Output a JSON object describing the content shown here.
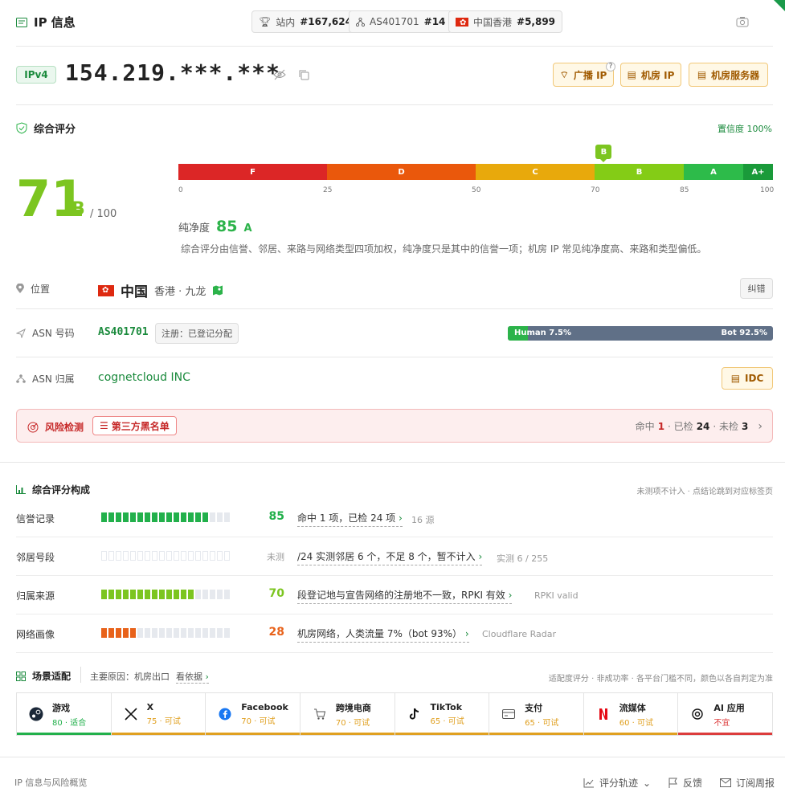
{
  "header": {
    "title": "IP 信息",
    "ranks": [
      {
        "label": "站内",
        "value": "#167,624"
      },
      {
        "label": "AS401701",
        "value": "#14"
      },
      {
        "label": "中国香港",
        "value": "#5,899"
      }
    ]
  },
  "ip": {
    "version": "IPv4",
    "address": "154.219.***.***",
    "tags": [
      "广播 IP",
      "机房 IP",
      "机房服务器"
    ],
    "help": "?"
  },
  "overall": {
    "title": "综合评分",
    "confidence": "置信度 100%",
    "score": "71",
    "grade": "B",
    "max": "/ 100",
    "marker_value": 71,
    "marker_label": "B",
    "bands": [
      {
        "label": "F",
        "from": 0,
        "to": 25,
        "color": "#dc2626"
      },
      {
        "label": "D",
        "from": 25,
        "to": 50,
        "color": "#ea580c"
      },
      {
        "label": "C",
        "from": 50,
        "to": 70,
        "color": "#e8a90c"
      },
      {
        "label": "B",
        "from": 70,
        "to": 85,
        "color": "#84cc16"
      },
      {
        "label": "A",
        "from": 85,
        "to": 95,
        "color": "#2dbb4a"
      },
      {
        "label": "A+",
        "from": 95,
        "to": 100,
        "color": "#1a9a3a"
      }
    ],
    "ticks": [
      "0",
      "25",
      "50",
      "70",
      "85",
      "100"
    ],
    "purity_label": "纯净度",
    "purity_value": "85",
    "purity_grade": "A",
    "note": "综合评分由信誉、邻居、来路与网络类型四项加权，纯净度只是其中的信誉一项；机房 IP 常见纯净度高、来路和类型偏低。"
  },
  "location": {
    "label": "位置",
    "country": "中国",
    "region": "香港 · 九龙",
    "fix_button": "纠错"
  },
  "asn": {
    "label": "ASN 号码",
    "number": "AS401701",
    "reg_badge": "注册：已登记分配",
    "human_label": "Human 7.5%",
    "bot_label": "Bot 92.5%",
    "human_pct": 7.5
  },
  "owner": {
    "label": "ASN 归属",
    "name": "cognetcloud INC",
    "tag": "IDC"
  },
  "risk": {
    "title": "风险检测",
    "badge": "第三方黑名单",
    "hit_label": "命中",
    "hit": "1",
    "checked_label": "· 已检",
    "checked": "24",
    "unchecked_label": "· 未检",
    "unchecked": "3"
  },
  "breakdown": {
    "title": "综合评分构成",
    "hint": "未测项不计入 · 点结论跳到对应标签页",
    "rows": [
      {
        "label": "信誉记录",
        "value": "85",
        "filled": 15,
        "total": 18,
        "color": "#22b04b",
        "value_color": "#22b04b",
        "desc": "命中 1 项，已检 24 项",
        "source": "16 源"
      },
      {
        "label": "邻居号段",
        "value": "未测",
        "filled": 0,
        "total": 18,
        "color": "#22b04b",
        "value_color": "#999999",
        "desc": "/24 实测邻居 6 个，不足 8 个，暂不计入",
        "source": "实测 6 / 255"
      },
      {
        "label": "归属来源",
        "value": "70",
        "filled": 13,
        "total": 18,
        "color": "#7cc520",
        "value_color": "#7cc520",
        "desc": "段登记地与宣告网络的注册地不一致，RPKI 有效",
        "source": "RPKI valid"
      },
      {
        "label": "网络画像",
        "value": "28",
        "filled": 5,
        "total": 18,
        "color": "#e8621a",
        "value_color": "#e8621a",
        "desc": "机房网络，人类流量 7%（bot 93%）",
        "source": "Cloudflare Radar"
      }
    ]
  },
  "scenario": {
    "title": "场景适配",
    "reason_label": "主要原因：",
    "reason": "机房出口",
    "evidence_link": "看依据",
    "hint": "适配度评分 · 非成功率 · 各平台门槛不同，颜色以各自判定为准",
    "cards": [
      {
        "icon": "steam-icon",
        "name": "游戏",
        "score": "80 · 适合",
        "color": "#22b04b"
      },
      {
        "icon": "x-icon",
        "name": "X",
        "score": "75 · 可试",
        "color": "#e0a020"
      },
      {
        "icon": "facebook-icon",
        "name": "Facebook",
        "score": "70 · 可试",
        "color": "#e0a020"
      },
      {
        "icon": "cart-icon",
        "name": "跨境电商",
        "score": "70 · 可试",
        "color": "#e0a020"
      },
      {
        "icon": "tiktok-icon",
        "name": "TikTok",
        "score": "65 · 可试",
        "color": "#e0a020"
      },
      {
        "icon": "card-icon",
        "name": "支付",
        "score": "65 · 可试",
        "color": "#e0a020"
      },
      {
        "icon": "netflix-icon",
        "name": "流媒体",
        "score": "60 · 可试",
        "color": "#e0a020"
      },
      {
        "icon": "openai-icon",
        "name": "AI 应用",
        "score": "不宜",
        "color": "#dc3c3c"
      }
    ]
  },
  "footer": {
    "left": "IP 信息与风险概览",
    "history": "评分轨迹",
    "feedback": "反馈",
    "subscribe": "订阅周报"
  }
}
